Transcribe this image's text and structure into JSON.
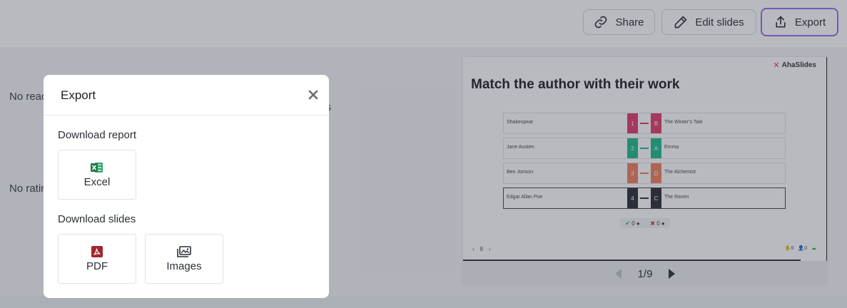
{
  "toolbar": {
    "share_label": "Share",
    "edit_label": "Edit slides",
    "export_label": "Export"
  },
  "background": {
    "text_1": "No reac",
    "text_2": "No ratin",
    "text_3": "ons"
  },
  "slide": {
    "logo": "AhaSlides",
    "title": "Match the author with their work",
    "rows": [
      {
        "left": "Shakespear",
        "num": "1",
        "letter": "B",
        "right": "The Winter's Tale",
        "color": "#e23b6b"
      },
      {
        "left": "Jane Austen",
        "num": "2",
        "letter": "A",
        "right": "Emma",
        "color": "#1fb98a"
      },
      {
        "left": "Ben Jonson",
        "num": "3",
        "letter": "D",
        "right": "The Alchemist",
        "color": "#f07e5c"
      },
      {
        "left": "Edgar Allan Poe",
        "num": "4",
        "letter": "C",
        "right": "The Raven",
        "color": "#2a2d35"
      }
    ],
    "tally_correct": "0",
    "tally_wrong": "0",
    "nav_page": "8",
    "stat_1": "0",
    "stat_2": "0"
  },
  "pager": {
    "label": "1/9"
  },
  "modal": {
    "title": "Export",
    "report_label": "Download report",
    "slides_label": "Download slides",
    "excel_label": "Excel",
    "pdf_label": "PDF",
    "images_label": "Images"
  },
  "colors": {
    "accent": "#9b6cf0",
    "excel": "#1f7a45",
    "pdf": "#a3262f"
  }
}
